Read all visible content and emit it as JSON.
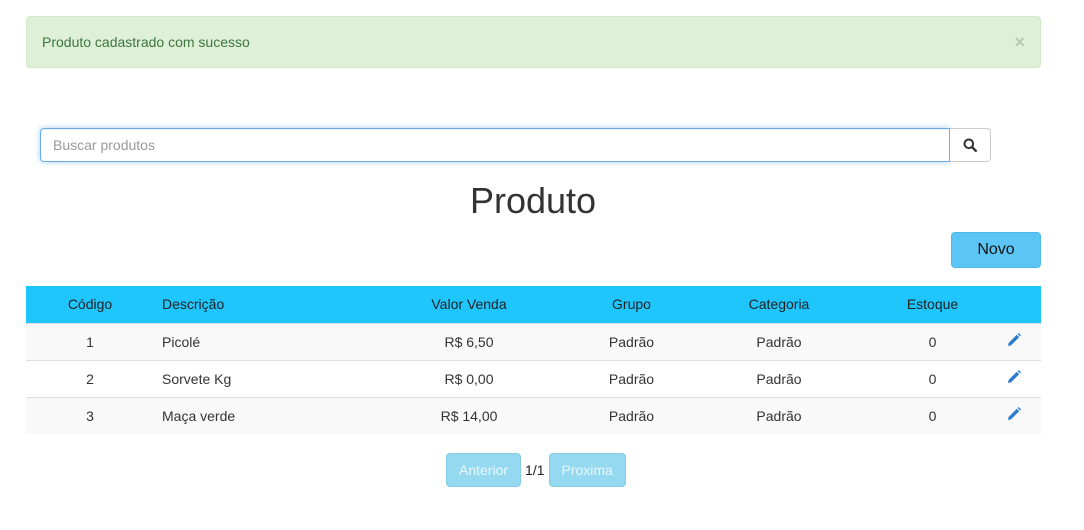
{
  "alert": {
    "message": "Produto cadastrado com sucesso",
    "close_glyph": "×"
  },
  "search": {
    "placeholder": "Buscar produtos",
    "value": "",
    "icon": "search-icon"
  },
  "page": {
    "title": "Produto",
    "new_button_label": "Novo"
  },
  "table": {
    "headers": [
      "Código",
      "Descrição",
      "Valor Venda",
      "Grupo",
      "Categoria",
      "Estoque",
      ""
    ],
    "rows": [
      {
        "codigo": "1",
        "descricao": "Picolé",
        "valor": "R$ 6,50",
        "grupo": "Padrão",
        "categoria": "Padrão",
        "estoque": "0"
      },
      {
        "codigo": "2",
        "descricao": "Sorvete Kg",
        "valor": "R$ 0,00",
        "grupo": "Padrão",
        "categoria": "Padrão",
        "estoque": "0"
      },
      {
        "codigo": "3",
        "descricao": "Maça verde",
        "valor": "R$ 14,00",
        "grupo": "Padrão",
        "categoria": "Padrão",
        "estoque": "0"
      }
    ],
    "row_action_icon": "pencil-icon"
  },
  "pagination": {
    "prev_label": "Anterior",
    "page_info": "1/1",
    "next_label": "Proxima"
  },
  "colors": {
    "alert_bg": "#dff0d8",
    "alert_text": "#3c763d",
    "table_header_bg": "#1ec6fd",
    "new_button_bg": "#5bc6f5",
    "pager_button_bg": "#94d9ef",
    "edit_icon": "#2a7bd1"
  }
}
